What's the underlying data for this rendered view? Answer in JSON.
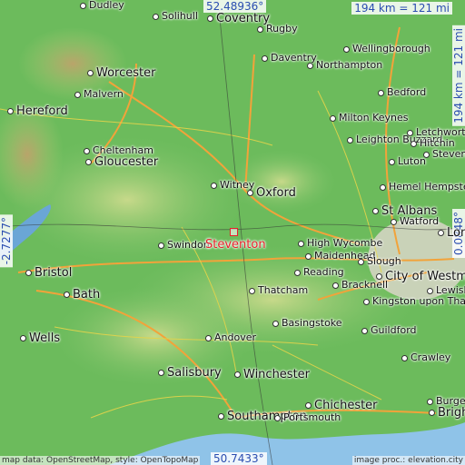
{
  "map": {
    "center_label": "Steventon",
    "coords": {
      "top": "52.48936°",
      "bottom": "50.7433°",
      "left": "-2.7277°",
      "right": "0.0848°"
    },
    "scale": {
      "horizontal": "194 km = 121 mi",
      "vertical": "194 km = 121 mi"
    },
    "footer": {
      "left": "map data: OpenStreetMap, style: OpenTopoMap",
      "right": "image proc.: elevation.city"
    },
    "cities": [
      {
        "name": "Dudley"
      },
      {
        "name": "Solihull"
      },
      {
        "name": "Coventry"
      },
      {
        "name": "Rugby"
      },
      {
        "name": "Wellingborough"
      },
      {
        "name": "Daventry"
      },
      {
        "name": "Northampton"
      },
      {
        "name": "Worcester"
      },
      {
        "name": "Malvern"
      },
      {
        "name": "Bedford"
      },
      {
        "name": "Hereford"
      },
      {
        "name": "Milton Keynes"
      },
      {
        "name": "Leighton Buzzard"
      },
      {
        "name": "Letchworth"
      },
      {
        "name": "Hitchin"
      },
      {
        "name": "Stevenage"
      },
      {
        "name": "Cheltenham"
      },
      {
        "name": "Gloucester"
      },
      {
        "name": "Luton"
      },
      {
        "name": "Hemel Hempstead"
      },
      {
        "name": "Witney"
      },
      {
        "name": "Oxford"
      },
      {
        "name": "St Albans"
      },
      {
        "name": "Watford"
      },
      {
        "name": "High Wycombe"
      },
      {
        "name": "Maidenhead"
      },
      {
        "name": "Swindon"
      },
      {
        "name": "Slough"
      },
      {
        "name": "London"
      },
      {
        "name": "City of Westminster"
      },
      {
        "name": "Bristol"
      },
      {
        "name": "Reading"
      },
      {
        "name": "Bracknell"
      },
      {
        "name": "Lewisham"
      },
      {
        "name": "Thatcham"
      },
      {
        "name": "Kingston upon Thames"
      },
      {
        "name": "Bath"
      },
      {
        "name": "Basingstoke"
      },
      {
        "name": "Guildford"
      },
      {
        "name": "Wells"
      },
      {
        "name": "Andover"
      },
      {
        "name": "Crawley"
      },
      {
        "name": "Salisbury"
      },
      {
        "name": "Winchester"
      },
      {
        "name": "Burgess Hill"
      },
      {
        "name": "Southampton"
      },
      {
        "name": "Chichester"
      },
      {
        "name": "Brighton"
      },
      {
        "name": "Portsmouth"
      }
    ]
  }
}
